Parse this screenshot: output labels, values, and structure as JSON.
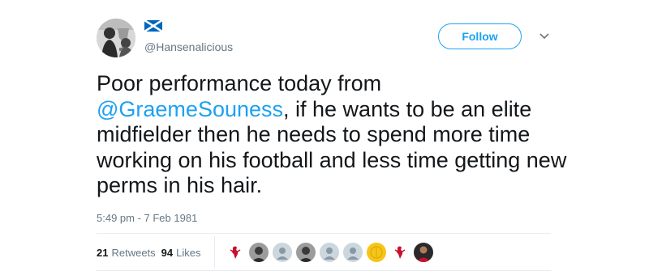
{
  "user": {
    "handle": "@Hansenalicious",
    "flag_icon": "scotland-flag-icon"
  },
  "follow_button": {
    "label": "Follow"
  },
  "more_menu": {
    "icon": "chevron-down-icon"
  },
  "tweet": {
    "text_before": "Poor performance today from ",
    "mention": "@GraemeSouness",
    "text_after": ", if he wants to be an elite midfielder then he needs to spend more time working on his football and less time getting new perms in his hair.",
    "timestamp": "5:49 pm - 7 Feb 1981"
  },
  "stats": {
    "retweets_count": "21",
    "retweets_label": "Retweets",
    "likes_count": "94",
    "likes_label": "Likes"
  },
  "likers": [
    {
      "type": "liverbird",
      "icon": "liverbird-icon"
    },
    {
      "type": "photo",
      "icon": "user-photo-avatar"
    },
    {
      "type": "default",
      "icon": "default-user-avatar"
    },
    {
      "type": "photo",
      "icon": "user-photo-avatar"
    },
    {
      "type": "default",
      "icon": "default-user-avatar"
    },
    {
      "type": "default",
      "icon": "default-user-avatar"
    },
    {
      "type": "badge",
      "icon": "yellow-badge-avatar"
    },
    {
      "type": "liverbird",
      "icon": "liverbird-icon"
    },
    {
      "type": "photo-red",
      "icon": "user-photo-avatar"
    }
  ],
  "colors": {
    "link_blue": "#1da1f2",
    "text_dark": "#14171a",
    "text_grey": "#657786",
    "liverpool_red": "#c8102e"
  }
}
